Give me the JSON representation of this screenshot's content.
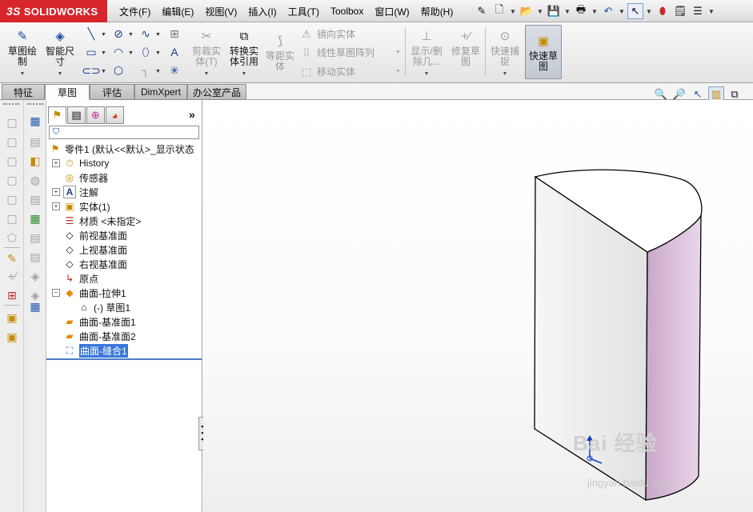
{
  "app": {
    "brand_prefix": "3S",
    "brand_name": "SOLIDWORKS"
  },
  "menu": [
    "文件(F)",
    "编辑(E)",
    "视图(V)",
    "插入(I)",
    "工具(T)",
    "Toolbox",
    "窗口(W)",
    "帮助(H)"
  ],
  "quick_icons": [
    "pin-icon",
    "new-document-icon",
    "open-folder-icon",
    "save-icon",
    "print-icon",
    "undo-icon",
    "select-arrow-icon",
    "traffic-light-icon",
    "options-icon",
    "customize-icon"
  ],
  "ribbon": {
    "sketch": "草图绘\n制",
    "smart_dim": "智能尺\n寸",
    "trim": "剪裁实\n体(T)",
    "convert": "转换实\n体引用",
    "offset": "等距实\n体",
    "mirror": "镜向实体",
    "linear_pattern": "线性草图阵列",
    "move": "移动实体",
    "show_delete": "显示/删\n除几...",
    "repair": "修复草\n图",
    "quick_snap": "快速捕\n捉",
    "quick_sketch": "快速草\n图"
  },
  "tabs": [
    "特征",
    "草图",
    "评估",
    "DimXpert",
    "办公室产品"
  ],
  "active_tab": "草图",
  "feature_tree": {
    "root": "零件1  (默认<<默认>_显示状态",
    "items": [
      {
        "label": "History",
        "icon": "history-icon",
        "toggle": "+"
      },
      {
        "label": "传感器",
        "icon": "sensor-icon",
        "toggle": ""
      },
      {
        "label": "注解",
        "icon": "annotation-icon",
        "toggle": "+"
      },
      {
        "label": "实体(1)",
        "icon": "solid-body-icon",
        "toggle": "+"
      },
      {
        "label": "材质 <未指定>",
        "icon": "material-icon",
        "toggle": ""
      },
      {
        "label": "前视基准面",
        "icon": "plane-icon",
        "toggle": ""
      },
      {
        "label": "上视基准面",
        "icon": "plane-icon",
        "toggle": ""
      },
      {
        "label": "右视基准面",
        "icon": "plane-icon",
        "toggle": ""
      },
      {
        "label": "原点",
        "icon": "origin-icon",
        "toggle": ""
      },
      {
        "label": "曲面-拉伸1",
        "icon": "surface-extrude-icon",
        "toggle": "−"
      },
      {
        "label": "(-) 草图1",
        "icon": "sketch-icon",
        "toggle": ""
      },
      {
        "label": "曲面-基准面1",
        "icon": "surface-plane-icon",
        "toggle": ""
      },
      {
        "label": "曲面-基准面2",
        "icon": "surface-plane-icon",
        "toggle": ""
      },
      {
        "label": "曲面-缝合1",
        "icon": "surface-knit-icon",
        "toggle": ""
      }
    ],
    "selected": "曲面-缝合1",
    "expand_label": "»"
  },
  "watermark": {
    "brand": "Bai 经验",
    "url": "jingyan.baidu.com"
  },
  "colors": {
    "accent": "#d7262c",
    "selection": "#3a78d8",
    "face_side": "#d8b8d8",
    "face_front": "#ececec"
  }
}
